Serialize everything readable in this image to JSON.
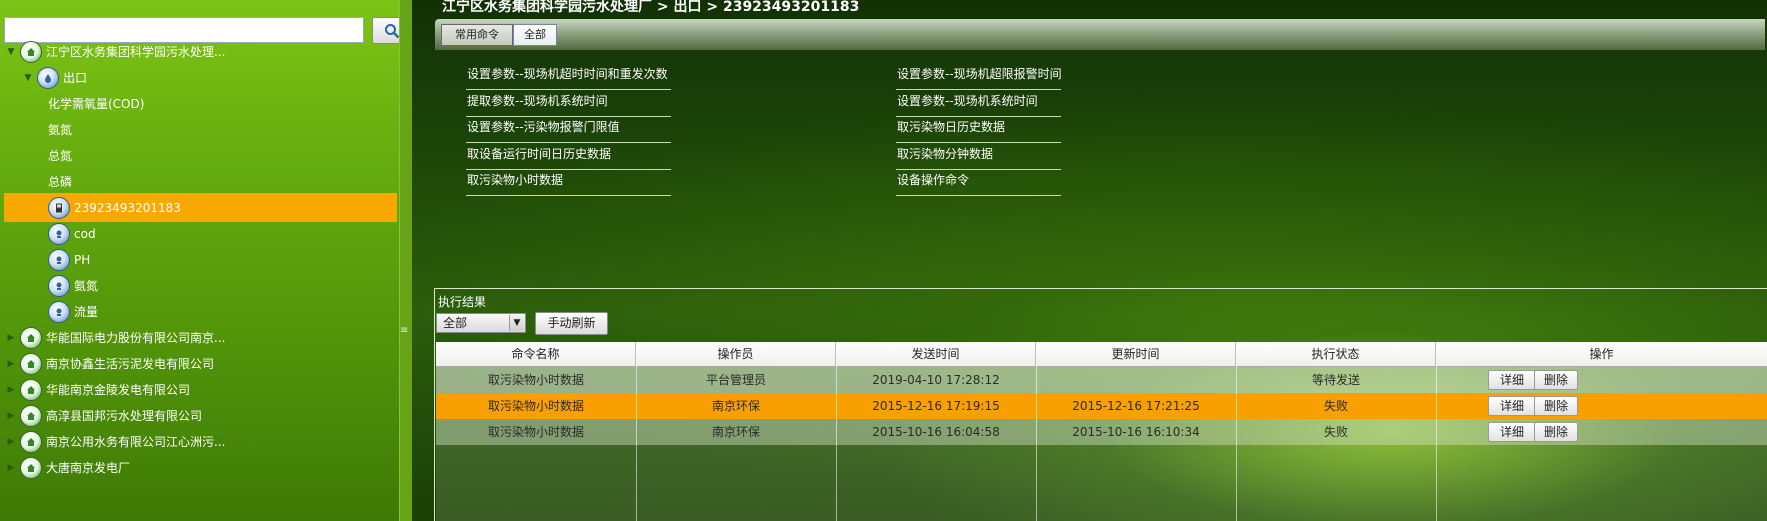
{
  "search": {
    "placeholder": "",
    "value": ""
  },
  "tree": {
    "items": [
      {
        "label": "江宁区水务集团科学园污水处理...",
        "level": 0,
        "toggle": "▼",
        "icon": "house-icon"
      },
      {
        "label": "出口",
        "level": 1,
        "toggle": "▼",
        "icon": "outlet-icon"
      },
      {
        "label": "化学需氧量(COD)",
        "level": 2
      },
      {
        "label": "氨氮",
        "level": 2
      },
      {
        "label": "总氮",
        "level": 2
      },
      {
        "label": "总磷",
        "level": 2
      },
      {
        "label": "23923493201183",
        "level": 2,
        "icon": "device-icon",
        "selected": true
      },
      {
        "label": "cod",
        "level": 2,
        "icon": "sensor-icon"
      },
      {
        "label": "PH",
        "level": 2,
        "icon": "sensor-icon"
      },
      {
        "label": "氨氮",
        "level": 2,
        "icon": "sensor-icon"
      },
      {
        "label": "流量",
        "level": 2,
        "icon": "sensor-icon"
      },
      {
        "label": "华能国际电力股份有限公司南京...",
        "level": 0,
        "toggle": "▶",
        "icon": "house-icon"
      },
      {
        "label": "南京协鑫生活污泥发电有限公司",
        "level": 0,
        "toggle": "▶",
        "icon": "house-icon"
      },
      {
        "label": "华能南京金陵发电有限公司",
        "level": 0,
        "toggle": "▶",
        "icon": "house-icon"
      },
      {
        "label": "高淳县国邦污水处理有限公司",
        "level": 0,
        "toggle": "▶",
        "icon": "house-icon"
      },
      {
        "label": "南京公用水务有限公司江心洲污...",
        "level": 0,
        "toggle": "▶",
        "icon": "house-icon"
      },
      {
        "label": "大唐南京发电厂",
        "level": 0,
        "toggle": "▶",
        "icon": "house-icon"
      }
    ]
  },
  "breadcrumb": "江宁区水务集团科学园污水处理厂 > 出口 > 23923493201183",
  "tabs": {
    "common": "常用命令",
    "all": "全部"
  },
  "commands": {
    "col1": [
      "设置参数--现场机超时时间和重发次数",
      "提取参数--现场机系统时间",
      "设置参数--污染物报警门限值",
      "取设备运行时间日历史数据",
      "取污染物小时数据"
    ],
    "col2": [
      "设置参数--现场机超限报警时间",
      "设置参数--现场机系统时间",
      "取污染物日历史数据",
      "取污染物分钟数据",
      "设备操作命令"
    ]
  },
  "results": {
    "title": "执行结果",
    "filter": "全部",
    "refresh": "手动刷新",
    "columns": [
      "命令名称",
      "操作员",
      "发送时间",
      "更新时间",
      "执行状态",
      "操作"
    ],
    "rows": [
      {
        "name": "取污染物小时数据",
        "operator": "平台管理员",
        "sent": "2019-04-10 17:28:12",
        "updated": "",
        "status": "等待发送",
        "selected": false
      },
      {
        "name": "取污染物小时数据",
        "operator": "南京环保",
        "sent": "2015-12-16 17:19:15",
        "updated": "2015-12-16 17:21:25",
        "status": "失败",
        "selected": true
      },
      {
        "name": "取污染物小时数据",
        "operator": "南京环保",
        "sent": "2015-10-16 16:04:58",
        "updated": "2015-10-16 16:10:34",
        "status": "失败",
        "selected": false
      }
    ],
    "actions": {
      "detail": "详细",
      "delete": "删除"
    }
  },
  "colors": {
    "selected": "#f8a800",
    "sidebar": "#66ad0e",
    "main": "#1f4a08"
  }
}
